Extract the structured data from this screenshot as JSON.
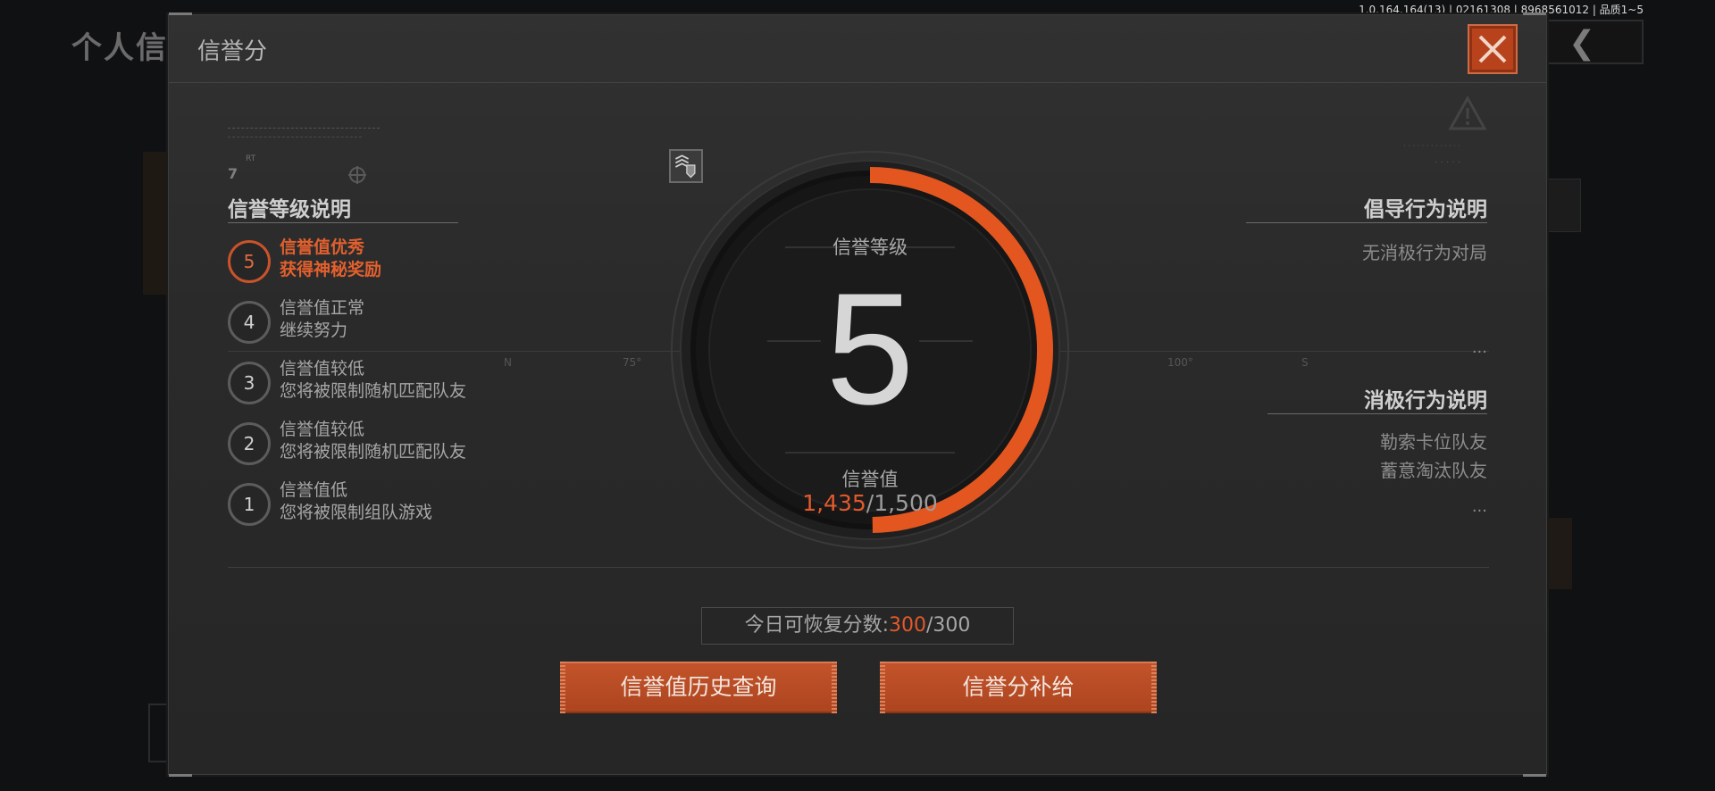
{
  "version_text": "1.0.164.164(13) | 02161308 | 8968561012 | 品质1~5",
  "background": {
    "title": "个人信",
    "back_icon": "chevron-left-icon"
  },
  "modal": {
    "title": "信誉分",
    "close_icon": "close-x-icon"
  },
  "hud": {
    "seven": "7",
    "rt": "RT",
    "compass": [
      "N",
      "75°",
      "100°",
      "S"
    ]
  },
  "levels_panel": {
    "title": "信誉等级说明",
    "levels": [
      {
        "num": "5",
        "line1": "信誉值优秀",
        "line2": "获得神秘奖励",
        "active": true
      },
      {
        "num": "4",
        "line1": "信誉值正常",
        "line2": "继续努力",
        "active": false
      },
      {
        "num": "3",
        "line1": "信誉值较低",
        "line2": "您将被限制随机匹配队友",
        "active": false
      },
      {
        "num": "2",
        "line1": "信誉值较低",
        "line2": "您将被限制随机匹配队友",
        "active": false
      },
      {
        "num": "1",
        "line1": "信誉值低",
        "line2": "您将被限制组队游戏",
        "active": false
      }
    ]
  },
  "gauge": {
    "level_label": "信誉等级",
    "level_value": "5",
    "score_label": "信誉值",
    "score_current": "1,435",
    "score_max": "/1,500",
    "progress": 0.9567,
    "badge_icon": "rank-chevrons-icon"
  },
  "right_panel": {
    "positive_title": "倡导行为说明",
    "positive_items": [
      "无消极行为对局"
    ],
    "positive_more": "...",
    "negative_title": "消极行为说明",
    "negative_items": [
      "勒索卡位队友",
      "蓄意淘汰队友"
    ],
    "negative_more": "..."
  },
  "recover": {
    "label": "今日可恢复分数:",
    "current": "300",
    "max": "/300"
  },
  "buttons": {
    "history": "信誉值历史查询",
    "supply": "信誉分补给"
  },
  "colors": {
    "accent": "#e3592b",
    "button": "#b84a22",
    "panel": "#2b2b2b"
  }
}
